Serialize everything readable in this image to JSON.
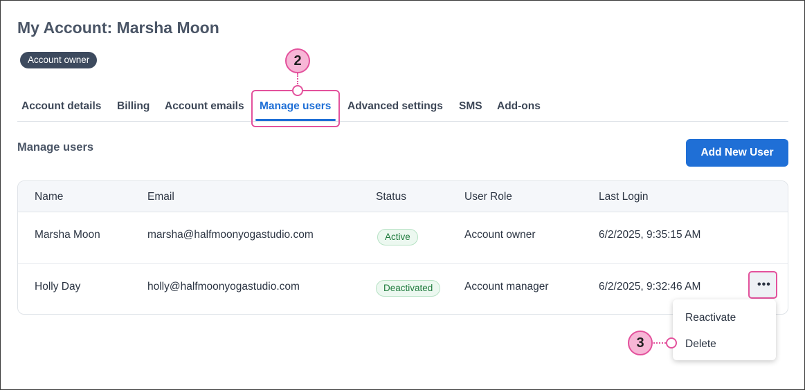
{
  "page": {
    "title": "My Account: Marsha Moon",
    "owner_badge": "Account owner"
  },
  "tabs": [
    {
      "label": "Account details"
    },
    {
      "label": "Billing"
    },
    {
      "label": "Account emails"
    },
    {
      "label": "Manage users",
      "active": true
    },
    {
      "label": "Advanced settings"
    },
    {
      "label": "SMS"
    },
    {
      "label": "Add-ons"
    }
  ],
  "section": {
    "title": "Manage users",
    "add_button": "Add New User"
  },
  "table": {
    "headers": [
      "Name",
      "Email",
      "Status",
      "User Role",
      "Last Login"
    ],
    "rows": [
      {
        "name": "Marsha Moon",
        "email": "marsha@halfmoonyogastudio.com",
        "status": "Active",
        "role": "Account owner",
        "last_login": "6/2/2025, 9:35:15 AM"
      },
      {
        "name": "Holly Day",
        "email": "holly@halfmoonyogastudio.com",
        "status": "Deactivated",
        "role": "Account manager",
        "last_login": "6/2/2025, 9:32:46 AM"
      }
    ]
  },
  "row_menu": {
    "trigger_label": "•••",
    "items": [
      "Reactivate",
      "Delete"
    ]
  },
  "callouts": {
    "step_2": "2",
    "step_3": "3"
  },
  "colors": {
    "accent": "#1f6fd6",
    "highlight": "#e3519c",
    "callout_fill": "#f7b6d6",
    "status_green": "#1e7a3c"
  },
  "icons": {
    "more": "ellipsis-icon"
  }
}
